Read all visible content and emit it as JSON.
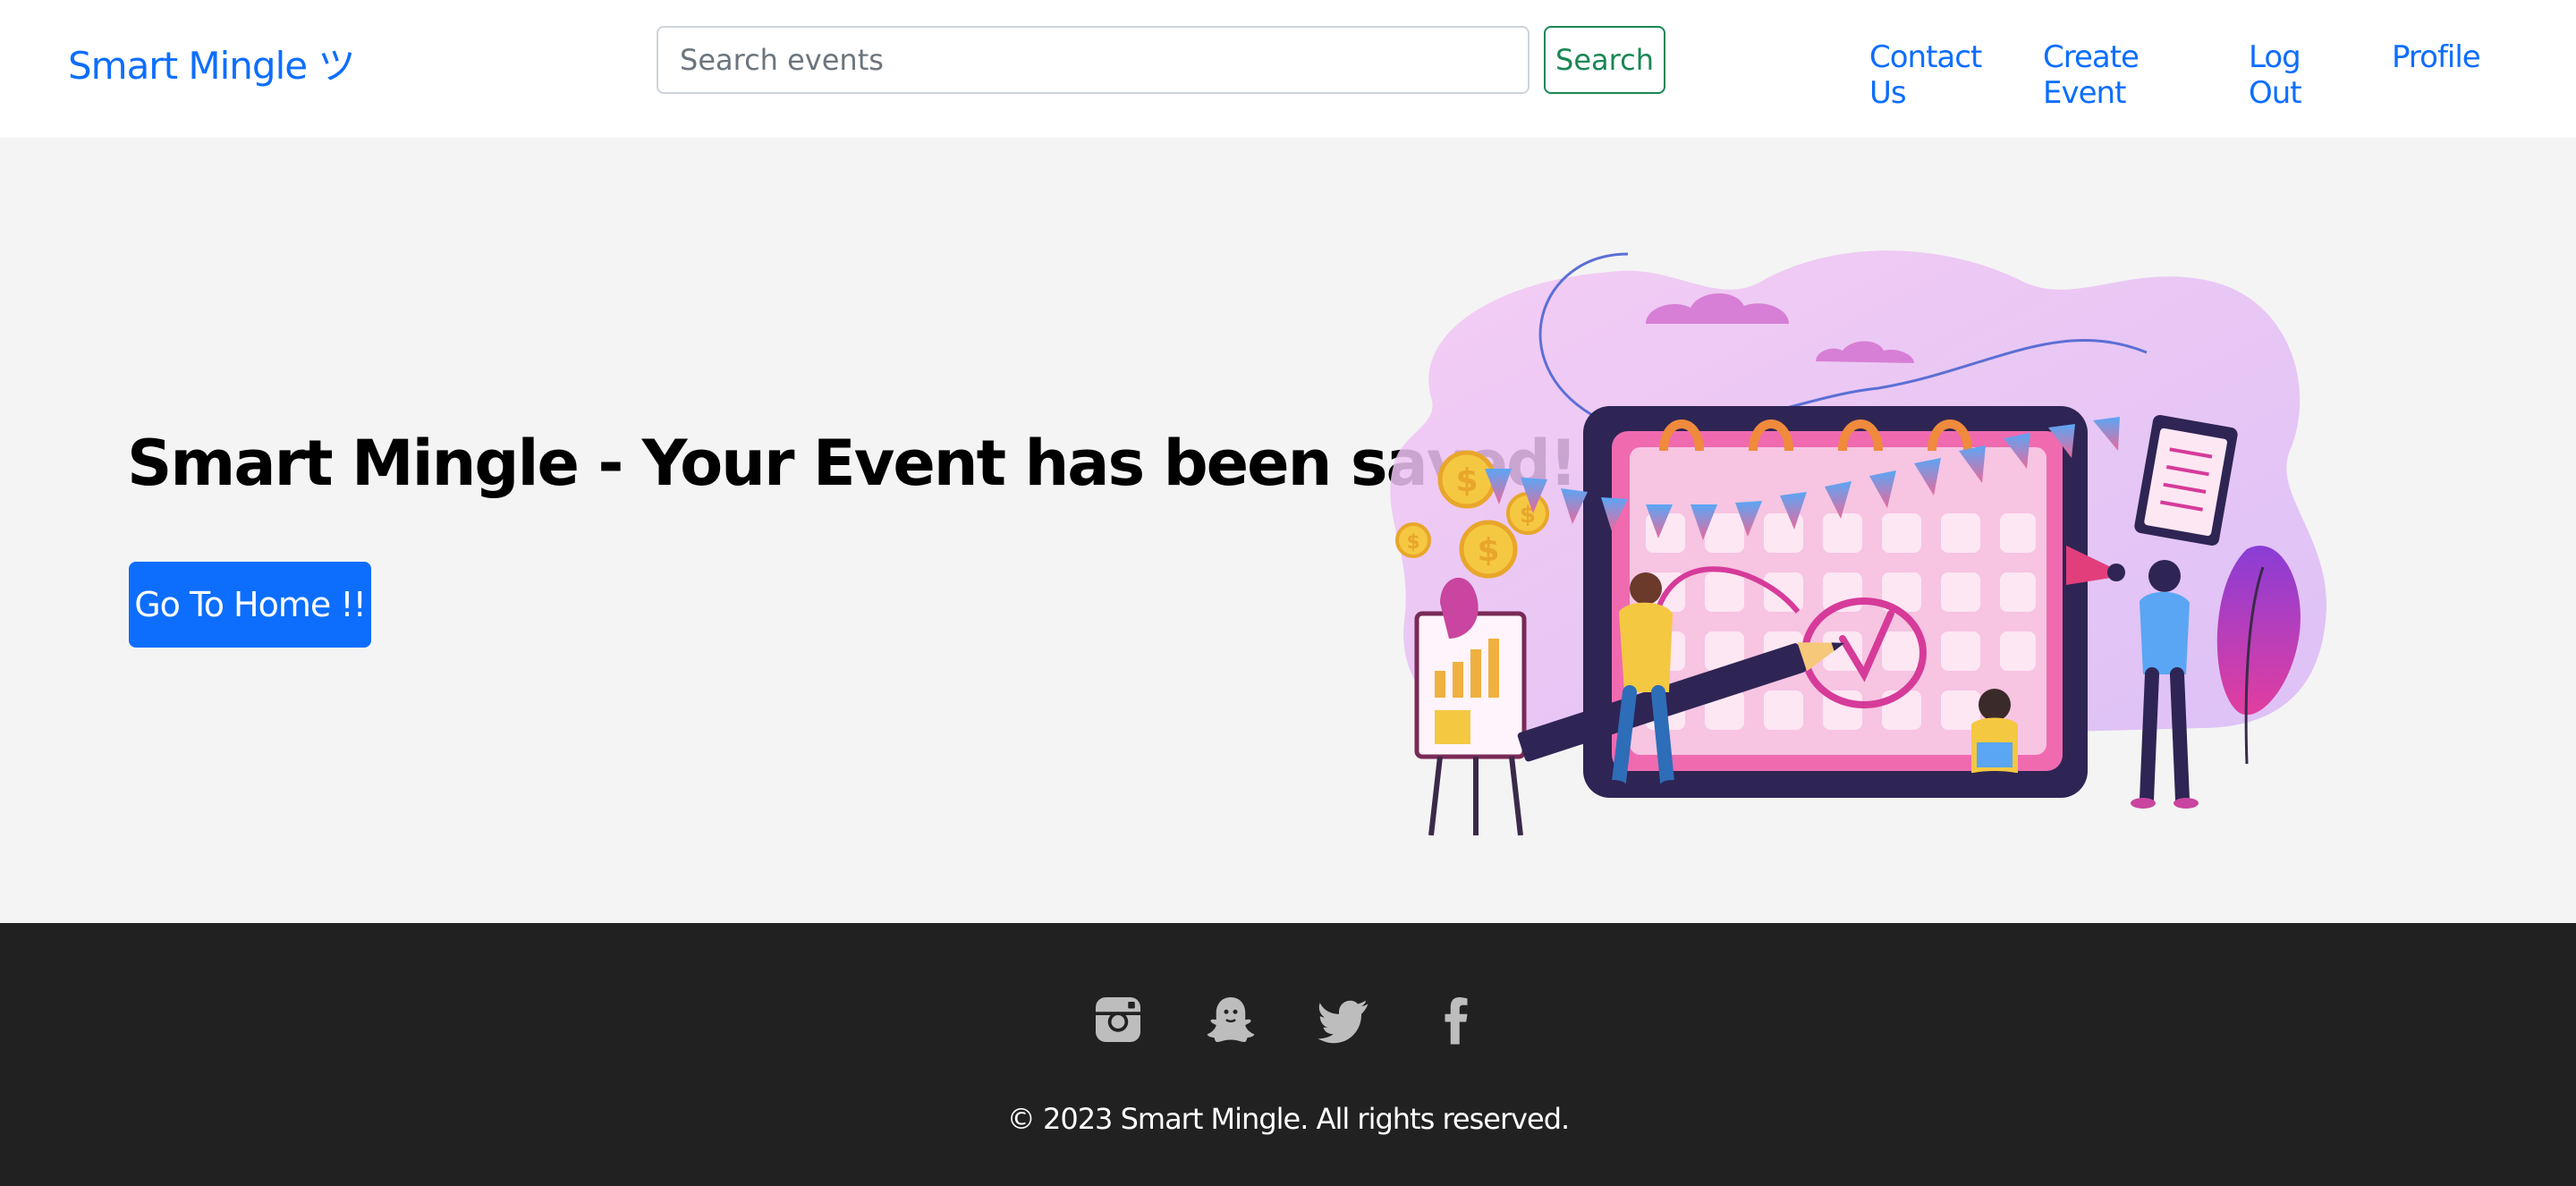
{
  "navbar": {
    "brand": "Smart Mingle ツ",
    "search": {
      "placeholder": "Search events",
      "value": ""
    },
    "search_button": "Search",
    "links": [
      "Contact Us",
      "Create Event",
      "Log Out",
      "Profile"
    ]
  },
  "hero": {
    "title": "Smart Mingle - Your Event has been saved! ツ",
    "button": "Go To Home !!",
    "illustration": "event-planning-calendar-illustration"
  },
  "footer": {
    "social_icons": [
      "instagram-icon",
      "snapchat-icon",
      "twitter-icon",
      "facebook-icon"
    ],
    "copyright": "© 2023 Smart Mingle. All rights reserved."
  },
  "colors": {
    "primary": "#0d6efd",
    "success": "#198754",
    "hero_bg": "#f4f4f4",
    "footer_bg": "#212121"
  }
}
